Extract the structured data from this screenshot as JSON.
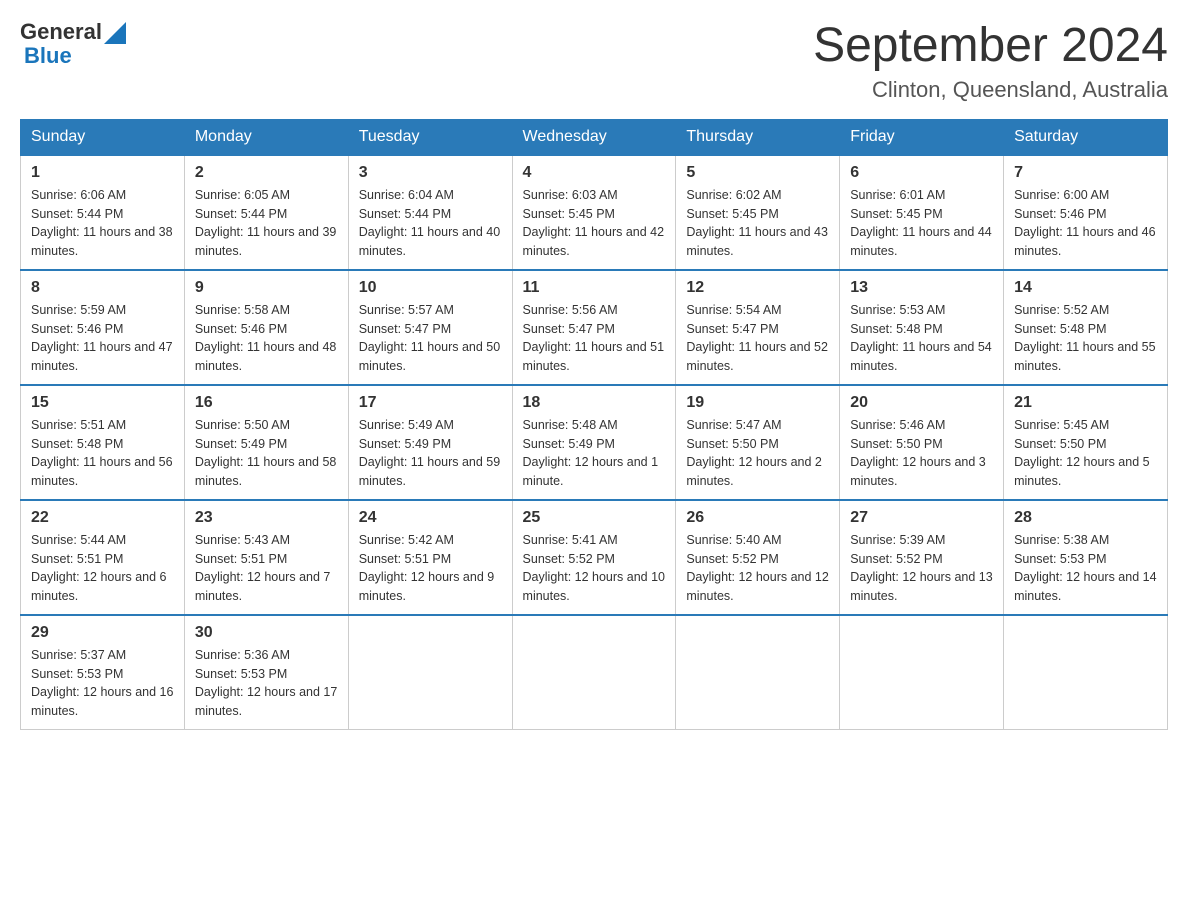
{
  "header": {
    "logo": {
      "general": "General",
      "blue": "Blue"
    },
    "title": "September 2024",
    "location": "Clinton, Queensland, Australia"
  },
  "days_of_week": [
    "Sunday",
    "Monday",
    "Tuesday",
    "Wednesday",
    "Thursday",
    "Friday",
    "Saturday"
  ],
  "weeks": [
    [
      {
        "day": 1,
        "sunrise": "6:06 AM",
        "sunset": "5:44 PM",
        "daylight": "11 hours and 38 minutes."
      },
      {
        "day": 2,
        "sunrise": "6:05 AM",
        "sunset": "5:44 PM",
        "daylight": "11 hours and 39 minutes."
      },
      {
        "day": 3,
        "sunrise": "6:04 AM",
        "sunset": "5:44 PM",
        "daylight": "11 hours and 40 minutes."
      },
      {
        "day": 4,
        "sunrise": "6:03 AM",
        "sunset": "5:45 PM",
        "daylight": "11 hours and 42 minutes."
      },
      {
        "day": 5,
        "sunrise": "6:02 AM",
        "sunset": "5:45 PM",
        "daylight": "11 hours and 43 minutes."
      },
      {
        "day": 6,
        "sunrise": "6:01 AM",
        "sunset": "5:45 PM",
        "daylight": "11 hours and 44 minutes."
      },
      {
        "day": 7,
        "sunrise": "6:00 AM",
        "sunset": "5:46 PM",
        "daylight": "11 hours and 46 minutes."
      }
    ],
    [
      {
        "day": 8,
        "sunrise": "5:59 AM",
        "sunset": "5:46 PM",
        "daylight": "11 hours and 47 minutes."
      },
      {
        "day": 9,
        "sunrise": "5:58 AM",
        "sunset": "5:46 PM",
        "daylight": "11 hours and 48 minutes."
      },
      {
        "day": 10,
        "sunrise": "5:57 AM",
        "sunset": "5:47 PM",
        "daylight": "11 hours and 50 minutes."
      },
      {
        "day": 11,
        "sunrise": "5:56 AM",
        "sunset": "5:47 PM",
        "daylight": "11 hours and 51 minutes."
      },
      {
        "day": 12,
        "sunrise": "5:54 AM",
        "sunset": "5:47 PM",
        "daylight": "11 hours and 52 minutes."
      },
      {
        "day": 13,
        "sunrise": "5:53 AM",
        "sunset": "5:48 PM",
        "daylight": "11 hours and 54 minutes."
      },
      {
        "day": 14,
        "sunrise": "5:52 AM",
        "sunset": "5:48 PM",
        "daylight": "11 hours and 55 minutes."
      }
    ],
    [
      {
        "day": 15,
        "sunrise": "5:51 AM",
        "sunset": "5:48 PM",
        "daylight": "11 hours and 56 minutes."
      },
      {
        "day": 16,
        "sunrise": "5:50 AM",
        "sunset": "5:49 PM",
        "daylight": "11 hours and 58 minutes."
      },
      {
        "day": 17,
        "sunrise": "5:49 AM",
        "sunset": "5:49 PM",
        "daylight": "11 hours and 59 minutes."
      },
      {
        "day": 18,
        "sunrise": "5:48 AM",
        "sunset": "5:49 PM",
        "daylight": "12 hours and 1 minute."
      },
      {
        "day": 19,
        "sunrise": "5:47 AM",
        "sunset": "5:50 PM",
        "daylight": "12 hours and 2 minutes."
      },
      {
        "day": 20,
        "sunrise": "5:46 AM",
        "sunset": "5:50 PM",
        "daylight": "12 hours and 3 minutes."
      },
      {
        "day": 21,
        "sunrise": "5:45 AM",
        "sunset": "5:50 PM",
        "daylight": "12 hours and 5 minutes."
      }
    ],
    [
      {
        "day": 22,
        "sunrise": "5:44 AM",
        "sunset": "5:51 PM",
        "daylight": "12 hours and 6 minutes."
      },
      {
        "day": 23,
        "sunrise": "5:43 AM",
        "sunset": "5:51 PM",
        "daylight": "12 hours and 7 minutes."
      },
      {
        "day": 24,
        "sunrise": "5:42 AM",
        "sunset": "5:51 PM",
        "daylight": "12 hours and 9 minutes."
      },
      {
        "day": 25,
        "sunrise": "5:41 AM",
        "sunset": "5:52 PM",
        "daylight": "12 hours and 10 minutes."
      },
      {
        "day": 26,
        "sunrise": "5:40 AM",
        "sunset": "5:52 PM",
        "daylight": "12 hours and 12 minutes."
      },
      {
        "day": 27,
        "sunrise": "5:39 AM",
        "sunset": "5:52 PM",
        "daylight": "12 hours and 13 minutes."
      },
      {
        "day": 28,
        "sunrise": "5:38 AM",
        "sunset": "5:53 PM",
        "daylight": "12 hours and 14 minutes."
      }
    ],
    [
      {
        "day": 29,
        "sunrise": "5:37 AM",
        "sunset": "5:53 PM",
        "daylight": "12 hours and 16 minutes."
      },
      {
        "day": 30,
        "sunrise": "5:36 AM",
        "sunset": "5:53 PM",
        "daylight": "12 hours and 17 minutes."
      },
      null,
      null,
      null,
      null,
      null
    ]
  ],
  "labels": {
    "sunrise": "Sunrise:",
    "sunset": "Sunset:",
    "daylight": "Daylight:"
  }
}
